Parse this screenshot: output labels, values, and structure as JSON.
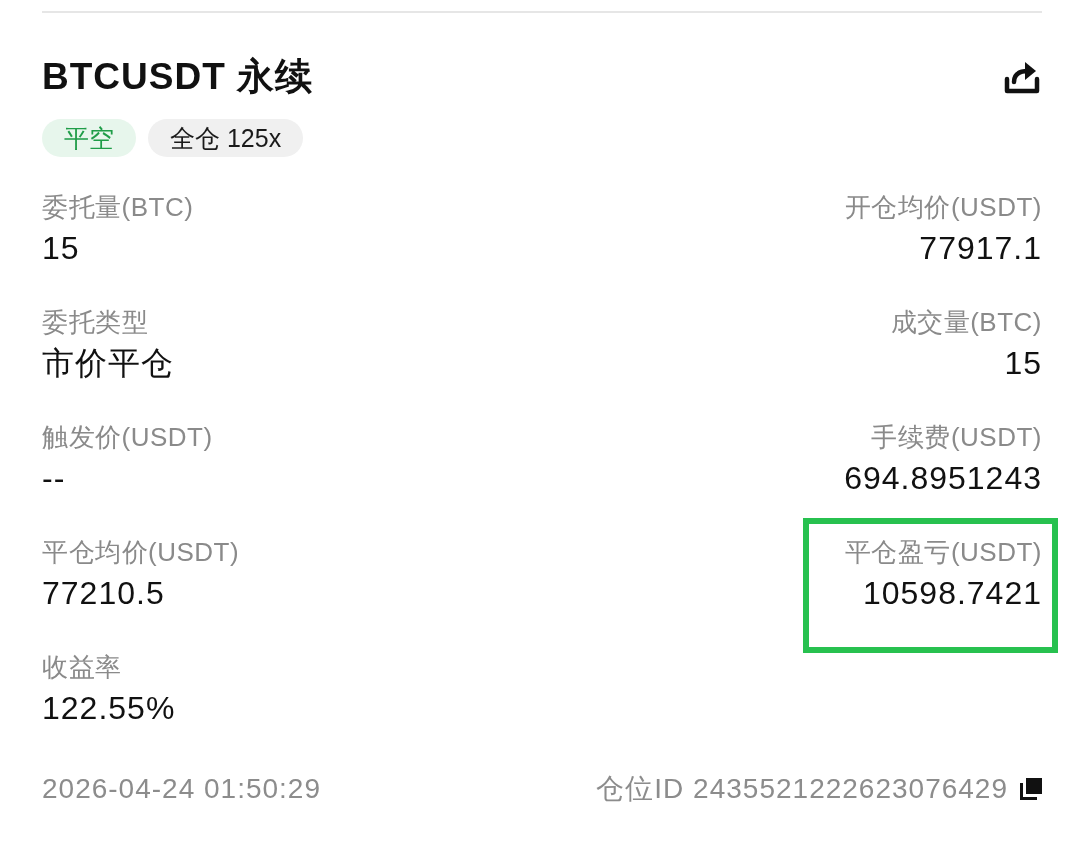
{
  "header": {
    "title": "BTCUSDT 永续",
    "tags": [
      {
        "kind": "side",
        "text": "平空"
      },
      {
        "kind": "margin",
        "text": "全仓 125x"
      }
    ]
  },
  "fields": [
    {
      "label": "委托量(BTC)",
      "value": "15",
      "highlighted": false
    },
    {
      "label": "开仓均价(USDT)",
      "value": "77917.1",
      "highlighted": false
    },
    {
      "label": "委托类型",
      "value": "市价平仓",
      "highlighted": false
    },
    {
      "label": "成交量(BTC)",
      "value": "15",
      "highlighted": false
    },
    {
      "label": "触发价(USDT)",
      "value": "--",
      "highlighted": false
    },
    {
      "label": "手续费(USDT)",
      "value": "694.8951243",
      "highlighted": false
    },
    {
      "label": "平仓均价(USDT)",
      "value": "77210.5",
      "highlighted": false
    },
    {
      "label": "平仓盈亏(USDT)",
      "value": "10598.7421",
      "highlighted": true
    },
    {
      "label": "收益率",
      "value": "122.55%",
      "highlighted": false
    }
  ],
  "footer": {
    "time": "2026-04-24 01:50:29",
    "position_id": "仓位ID 2435521222623076429"
  }
}
